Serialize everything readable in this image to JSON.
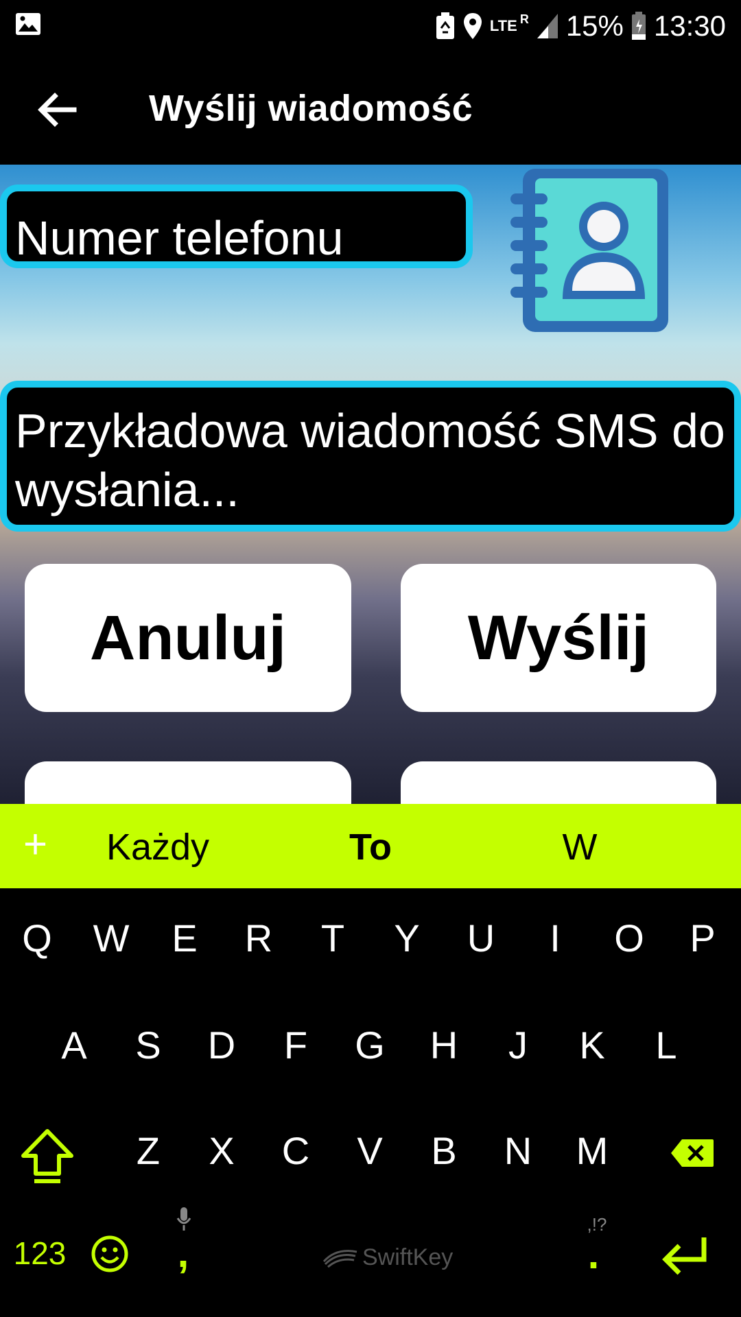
{
  "status_bar": {
    "battery": "15%",
    "time": "13:30",
    "network": "LTE",
    "roaming": "R"
  },
  "app_bar": {
    "title": "Wyślij wiadomość"
  },
  "form": {
    "phone_placeholder": "Numer telefonu",
    "message_text": "Przykładowa wiadomość SMS do wysłania...",
    "cancel_label": "Anuluj",
    "send_label": "Wyślij"
  },
  "keyboard": {
    "suggestions": [
      "Każdy",
      "To",
      "W"
    ],
    "row1": [
      "Q",
      "W",
      "E",
      "R",
      "T",
      "Y",
      "U",
      "I",
      "O",
      "P"
    ],
    "row2": [
      "A",
      "S",
      "D",
      "F",
      "G",
      "H",
      "J",
      "K",
      "L"
    ],
    "row3": [
      "Z",
      "X",
      "C",
      "V",
      "B",
      "N",
      "M"
    ],
    "numbers_label": "123",
    "comma_label": ",",
    "period_label": ".",
    "punct_hint": ",!?",
    "brand": "SwiftKey",
    "accent_color": "#c4ff00"
  },
  "colors": {
    "field_border": "#1bc8ee",
    "icon_teal": "#5ad9d6",
    "icon_blue": "#2e6db3"
  }
}
